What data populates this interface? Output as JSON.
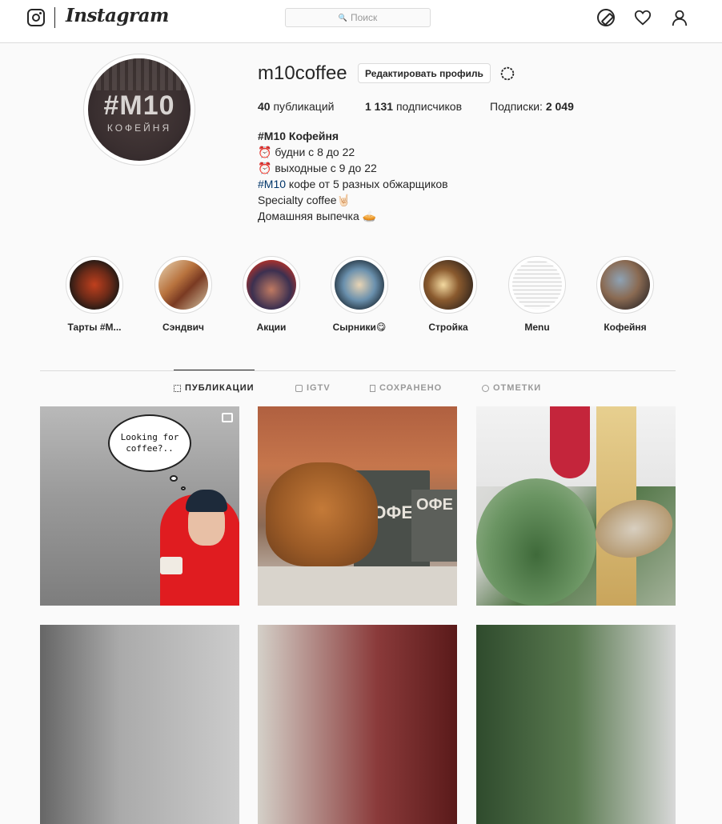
{
  "app": {
    "name": "Instagram",
    "search_placeholder": "Поиск"
  },
  "nav": {
    "icons": [
      "camera-icon",
      "compass-icon",
      "heart-icon",
      "user-icon"
    ]
  },
  "profile": {
    "username": "m10coffee",
    "edit_button": "Редактировать профиль",
    "avatar_text": "#M10",
    "avatar_sub": "КОФЕЙНЯ",
    "stats": {
      "posts_count": "40",
      "posts_label": "публикаций",
      "followers_count": "1 131",
      "followers_label": "подписчиков",
      "following_label": "Подписки:",
      "following_count": "2 049"
    },
    "bio": {
      "name": "#M10 Кофейня",
      "line1": "⏰ будни с 8 до 22",
      "line2": "⏰ выходные с 9 до 22",
      "line3_tag": "#M10",
      "line3_rest": " кофе от 5 разных обжарщиков",
      "line4": "Specialty coffee🤘🏻",
      "line5": "Домашняя выпечка 🥧"
    }
  },
  "highlights": [
    {
      "label": "Тарты #M...",
      "color": "#3a2a22"
    },
    {
      "label": "Сэндвич",
      "color": "#b87a4a"
    },
    {
      "label": "Акции",
      "color": "#6a4a3e"
    },
    {
      "label": "Сырники😋",
      "color": "#6d8aa0"
    },
    {
      "label": "Стройка",
      "color": "#8a6a3a"
    },
    {
      "label": "Menu",
      "color": "#e8e8e8"
    },
    {
      "label": "Кофейня",
      "color": "#7a6a5e"
    }
  ],
  "tabs": [
    {
      "label": "ПУБЛИКАЦИИ",
      "active": true
    },
    {
      "label": "IGTV",
      "active": false
    },
    {
      "label": "СОХРАНЕНО",
      "active": false
    },
    {
      "label": "ОТМЕТКИ",
      "active": false
    }
  ],
  "posts": {
    "p1_bubble_line1": "Looking for",
    "p1_bubble_line2": "coffee?..",
    "p2_box1": "КОФЕ",
    "p2_box2": "ОФЕ"
  },
  "colors": {
    "link": "#003569",
    "border": "#dbdbdb",
    "text": "#262626",
    "muted": "#999999"
  }
}
